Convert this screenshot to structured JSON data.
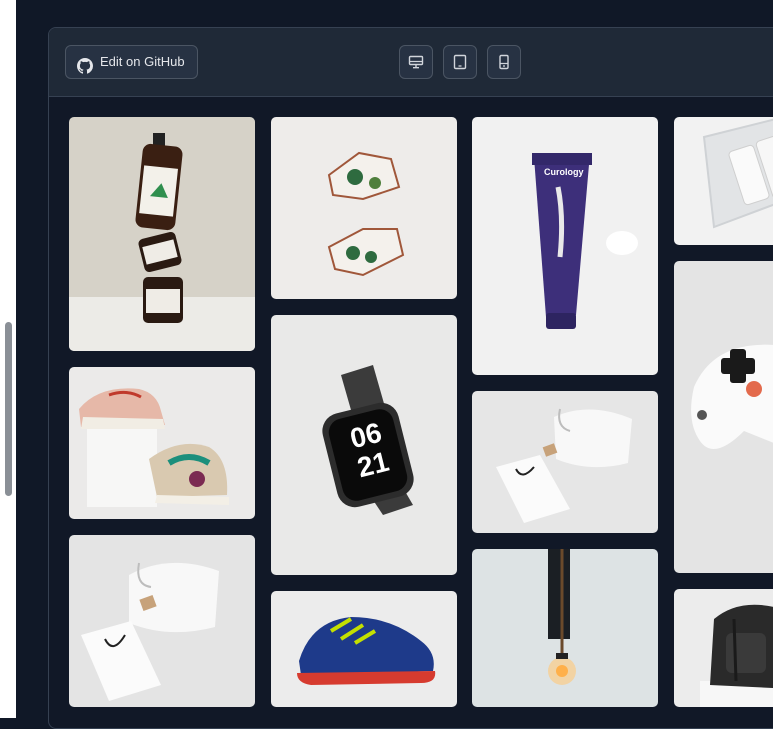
{
  "toolbar": {
    "github_label": "Edit on GitHub",
    "github_icon": "github-icon",
    "view_buttons": [
      {
        "name": "desktop-view-button",
        "icon": "monitor-icon"
      },
      {
        "name": "tablet-view-button",
        "icon": "tablet-icon"
      },
      {
        "name": "mobile-view-button",
        "icon": "smartphone-icon"
      }
    ]
  },
  "gallery": {
    "images": [
      {
        "name": "cbd-oil-jars-image",
        "subject": "stacked hemp oil bottle and jars"
      },
      {
        "name": "geometric-planters-image",
        "subject": "copper geometric wall planters"
      },
      {
        "name": "curology-tube-image",
        "subject": "purple skincare tube with cream"
      },
      {
        "name": "glass-cosmetics-image",
        "subject": "cosmetic bottles on glass tray"
      },
      {
        "name": "sneakers-image",
        "subject": "colorful sneakers on white block"
      },
      {
        "name": "apple-watch-image",
        "subject": "smartwatch with Nike face"
      },
      {
        "name": "tote-bag-image-1",
        "subject": "white cotton pouch and paper bag"
      },
      {
        "name": "game-controller-image",
        "subject": "white game controller"
      },
      {
        "name": "tote-bag-image-2",
        "subject": "white cotton pouch and paper bag"
      },
      {
        "name": "football-boot-image",
        "subject": "blue and red football boot"
      },
      {
        "name": "pendant-lamp-image",
        "subject": "hanging pendant bulb lamp"
      },
      {
        "name": "backpack-image",
        "subject": "black leather backpack"
      }
    ],
    "watch_face_text": [
      "06",
      "21"
    ],
    "tube_brand": "Curology"
  },
  "colors": {
    "page_bg": "#101827",
    "toolbar_bg": "#1f2937",
    "button_bg": "#273243",
    "button_border": "#4b5563",
    "text": "#e5e7eb"
  }
}
